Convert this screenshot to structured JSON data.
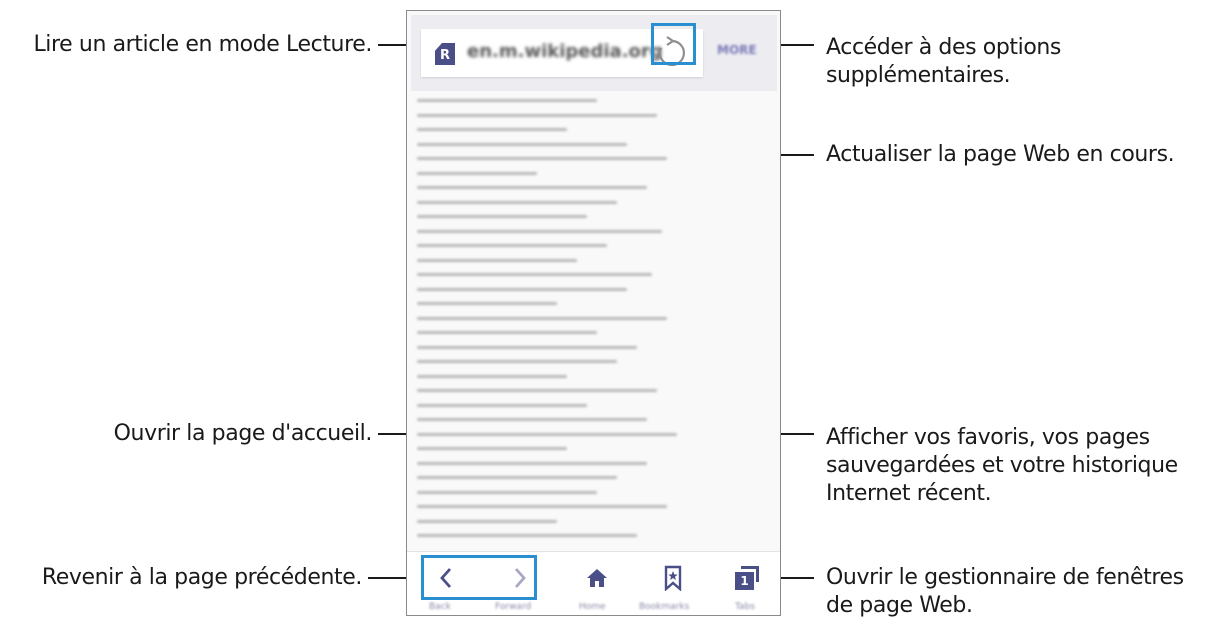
{
  "callouts": {
    "reader_mode": "Lire un article en mode Lecture.",
    "more_options_line1": "Accéder à des options",
    "more_options_line2": "supplémentaires.",
    "refresh": "Actualiser la page Web en cours.",
    "home": "Ouvrir la page d'accueil.",
    "bookmarks_line1": "Afficher vos favoris, vos pages",
    "bookmarks_line2": "sauvegardées et votre historique",
    "bookmarks_line3": "Internet récent.",
    "back": "Revenir à la page précédente.",
    "tabs_line1": "Ouvrir le gestionnaire de fenêtres",
    "tabs_line2": "de page Web."
  },
  "browser": {
    "url": "en.m.wikipedia.org",
    "more_label": "MORE",
    "reader_icon_letter": "R",
    "tabs_count": "1",
    "toolbar_labels": [
      "Back",
      "Forward",
      "Home",
      "Bookmarks",
      "Tabs"
    ]
  },
  "colors": {
    "callout_frame": "#2a8fd0",
    "toolbar_icon": "#4a4f88",
    "leader_line": "#1a1a1a"
  },
  "icons": [
    "reader-mode-icon",
    "refresh-icon",
    "back-icon",
    "forward-icon",
    "home-icon",
    "bookmark-icon",
    "tabs-icon"
  ]
}
